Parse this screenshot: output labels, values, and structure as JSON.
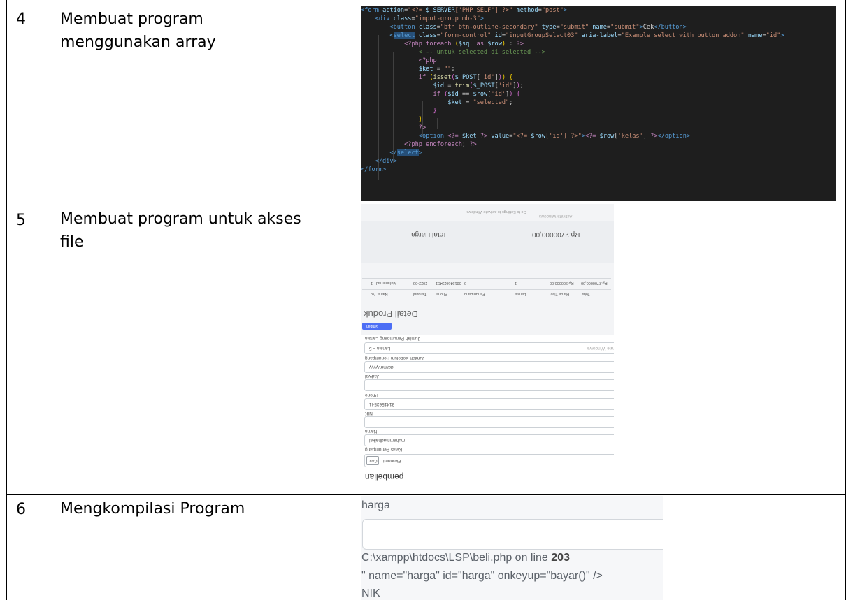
{
  "rows": [
    {
      "number": "4",
      "description_lines": [
        "Membuat program",
        "menggunakan array"
      ]
    },
    {
      "number": "5",
      "description_lines": [
        "Membuat program untuk akses",
        "file"
      ]
    },
    {
      "number": "6",
      "description_lines": [
        "Mengkompilasi Program"
      ]
    }
  ],
  "code_lines": [
    "<form action=\"<?= $_SERVER['PHP_SELF'] ?>\" method=\"post\">",
    "    <div class=\"input-group mb-3\">",
    "        <button class=\"btn btn-outline-secondary\" type=\"submit\" name=\"submit\">Cek</button>",
    "        <select class=\"form-control\" id=\"inputGroupSelect03\" aria-label=\"Example select with button addon\" name=\"id\">",
    "            <?php foreach ($sql as $row) : ?>",
    "                <!-- untuk selected di selected -->",
    "                <?php",
    "                $ket = \"\";",
    "                if (isset($_POST['id'])) {",
    "                    $id = trim($_POST['id']);",
    "                    if ($id == $row['id']) {",
    "                        $ket = \"selected\";",
    "                    }",
    "                }",
    "                ?>",
    "                <option <?= $ket ?> value=\"<?= $row['id'] ?>\"><?= $row['kelas'] ?></option>",
    "            <?php endforeach; ?>",
    "        </select>",
    "    </div>",
    "</form>"
  ],
  "row5_screenshot": {
    "total_label": "Total Harga",
    "total_value": "Rp.2700000,00",
    "section_title": "Detail Produk",
    "button_label": "Simpan",
    "table_headers": [
      "No",
      "Nama",
      "Tanggal",
      "Phone",
      "Penumpang",
      "Jumlah Sebelum Penumpang",
      "Lansia",
      "Harga Tiket",
      "Total"
    ],
    "table_row": [
      "1",
      "Muhammad",
      "2022-03",
      "081345623451",
      "3",
      "",
      "1",
      "Rp.900000,00",
      "Rp.2700000,00"
    ],
    "activate_windows": "Activate Windows",
    "activate_hint": "Go to Settings to activate Windows.",
    "form_labels": [
      "Jumlah Penumpang Lansia",
      "Jumlah Sebelum Penumpang",
      "Jadwal",
      "Phone",
      "NIK",
      "Nama",
      "Kelas Penumpang"
    ],
    "form_values": [
      "Lansia = 5",
      "dd/mm/yyyy",
      "",
      "3141563541",
      "",
      "muhammadhaikal",
      "Ekonomi"
    ],
    "cek_label": "Cek",
    "heading": "pembelian"
  },
  "row6_screenshot": {
    "label_harga": "harga",
    "error_path": "C:\\xampp\\htdocs\\LSP\\beli.php on line ",
    "error_line": "203",
    "code_fragment": "\" name=\"harga\" id=\"harga\" onkeyup=\"bayar()\" />",
    "label_nik": "NIK"
  }
}
